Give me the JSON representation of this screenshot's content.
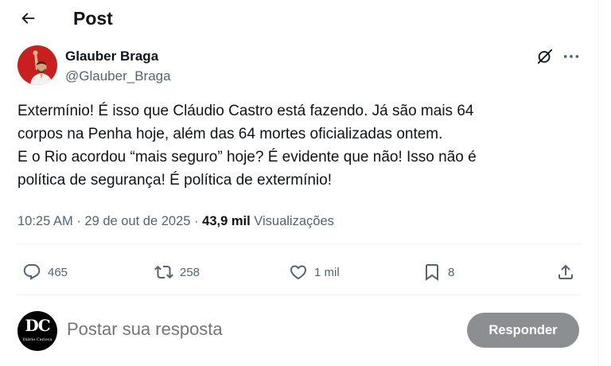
{
  "header": {
    "back_icon": "arrow-left-icon",
    "title": "Post"
  },
  "author": {
    "name": "Glauber Braga",
    "handle": "@Glauber_Braga",
    "avatar_bg": "#c8201f"
  },
  "post": {
    "lines": [
      "Extermínio! É isso que Cláudio Castro está fazendo. Já são mais 64",
      "corpos na Penha hoje, além das 64 mortes oficializadas ontem.",
      "E o Rio acordou “mais seguro” hoje? É evidente que não! Isso não é",
      "política de segurança! É política de extermínio!"
    ],
    "time": "10:25 AM",
    "date": "29 de out de 2025",
    "separator": "·",
    "views_count": "43,9 mil",
    "views_label": "Visualizações"
  },
  "actions": {
    "replies": "465",
    "reposts": "258",
    "likes": "1 mil",
    "bookmarks": "8"
  },
  "reply_box": {
    "placeholder": "Postar sua resposta",
    "button_label": "Responder",
    "avatar_letters": "DC",
    "avatar_subtitle": "Diário Carioca"
  },
  "colors": {
    "text": "#0f1419",
    "secondary": "#536471",
    "divider": "#eff3f4",
    "button_disabled": "#8b8f92"
  }
}
